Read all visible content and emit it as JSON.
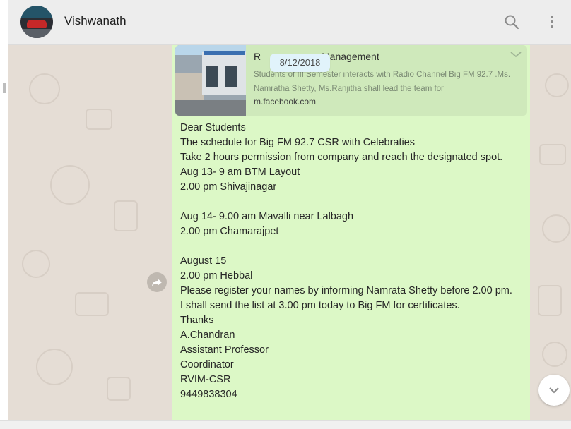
{
  "header": {
    "contact_name": "Vishwanath",
    "search_icon": "search-icon",
    "menu_icon": "kebab-menu-icon"
  },
  "link_preview": {
    "title_start": "R",
    "title_end": " Management",
    "description": "Students of III Semester interacts with Radio Channel Big FM 92.7 .Ms. Namratha Shetty, Ms.Ranjitha shall lead the team for",
    "link": "m.facebook.com"
  },
  "date_chip": "8/12/2018",
  "message": {
    "lines": [
      "Dear Students",
      "The schedule for Big FM 92.7 CSR with Celebraties",
      "Take 2 hours permission from company and reach the designated spot.",
      "Aug 13- 9 am BTM Layout",
      "2.00 pm Shivajinagar",
      "",
      "Aug 14- 9.00 am Mavalli near Lalbagh",
      "2.00 pm Chamarajpet",
      "",
      "August 15",
      "2.00 pm Hebbal",
      "Please register your names by informing Namrata Shetty before 2.00 pm.",
      "I shall send the list at 3.00 pm today to Big FM for certificates.",
      "Thanks",
      "A.Chandran",
      "Assistant Professor",
      "Coordinator",
      "RVIM-CSR",
      "9449838304"
    ]
  },
  "icons": {
    "forward": "forward-icon",
    "chevron": "chevron-down-icon",
    "scroll_down": "chevron-down-icon"
  },
  "colors": {
    "header_bg": "#ededed",
    "chat_bg": "#e5ddd5",
    "bubble_bg": "#dcf8c6",
    "preview_bg": "#cfe9bb",
    "date_chip_bg": "#e1f3fb"
  }
}
